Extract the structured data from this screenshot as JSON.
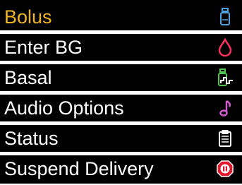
{
  "menu": {
    "selected_index": 0,
    "items": [
      {
        "label": "Bolus",
        "icon": "vial-icon",
        "icon_color": "#4da3e0"
      },
      {
        "label": "Enter BG",
        "icon": "blood-drop-icon",
        "icon_color": "#ff2f5a"
      },
      {
        "label": "Basal",
        "icon": "basal-vial-icon",
        "icon_color": "#4cc94c"
      },
      {
        "label": "Audio Options",
        "icon": "music-note-icon",
        "icon_color": "#d45ad4"
      },
      {
        "label": "Status",
        "icon": "clipboard-icon",
        "icon_color": "#ffffff"
      },
      {
        "label": "Suspend Delivery",
        "icon": "pause-octagon-icon",
        "icon_color": "#e4162b"
      }
    ]
  },
  "colors": {
    "background": "#000000",
    "text": "#ffffff",
    "selected_text": "#f0b323"
  }
}
